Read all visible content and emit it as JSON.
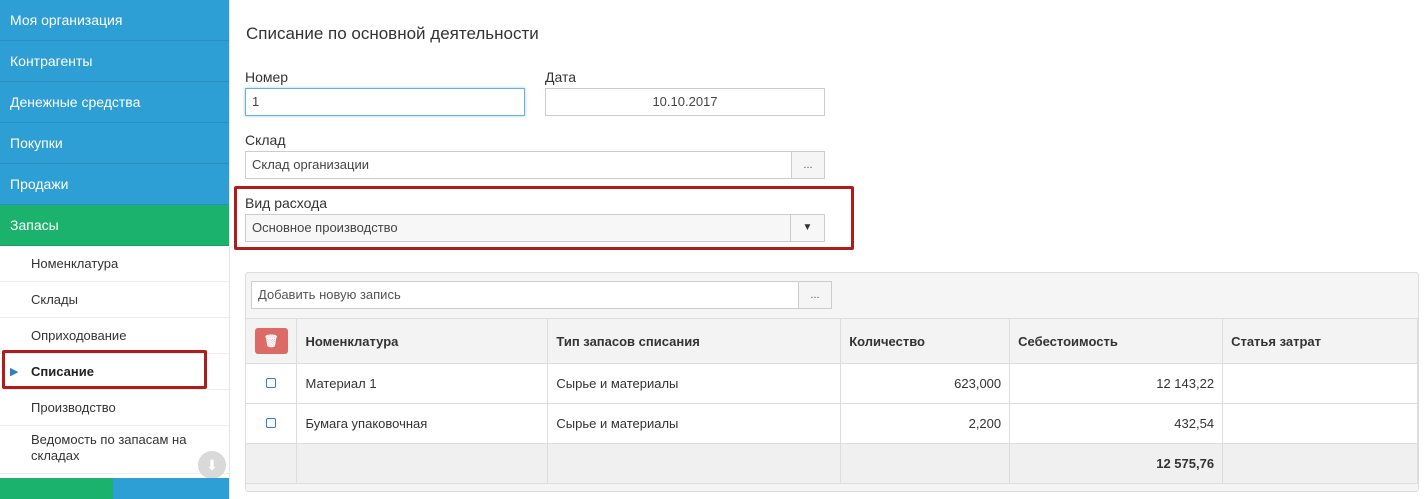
{
  "sidebar": {
    "menu": [
      {
        "label": "Моя организация"
      },
      {
        "label": "Контрагенты"
      },
      {
        "label": "Денежные средства"
      },
      {
        "label": "Покупки"
      },
      {
        "label": "Продажи"
      },
      {
        "label": "Запасы"
      }
    ],
    "submenu": [
      {
        "label": "Номенклатура"
      },
      {
        "label": "Склады"
      },
      {
        "label": "Оприходование"
      },
      {
        "label": "Списание"
      },
      {
        "label": "Производство"
      },
      {
        "label": "Ведомость по запасам на складах"
      }
    ],
    "current_arrow": "▶",
    "scroll_icon": "arrow-down-circle-icon",
    "colors": {
      "menu": "#2e9fd4",
      "active": "#1ab26c"
    }
  },
  "form": {
    "title": "Списание по основной деятельности",
    "number_label": "Номер",
    "number_value": "1",
    "date_label": "Дата",
    "date_value": "10.10.2017",
    "warehouse_label": "Склад",
    "warehouse_value": "Склад организации",
    "warehouse_btn": "...",
    "expense_label": "Вид расхода",
    "expense_value": "Основное производство"
  },
  "table": {
    "add_placeholder": "Добавить новую запись",
    "add_btn": "...",
    "delete_icon": "trash-icon",
    "columns": [
      "Номенклатура",
      "Тип запасов списания",
      "Количество",
      "Себестоимость",
      "Статья затрат"
    ],
    "rows": [
      {
        "name": "Материал 1",
        "type": "Сырье и материалы",
        "qty": "623,000",
        "cost": "12 143,22",
        "article": ""
      },
      {
        "name": "Бумага упаковочная",
        "type": "Сырье и материалы",
        "qty": "2,200",
        "cost": "432,54",
        "article": ""
      }
    ],
    "total_cost": "12 575,76"
  }
}
